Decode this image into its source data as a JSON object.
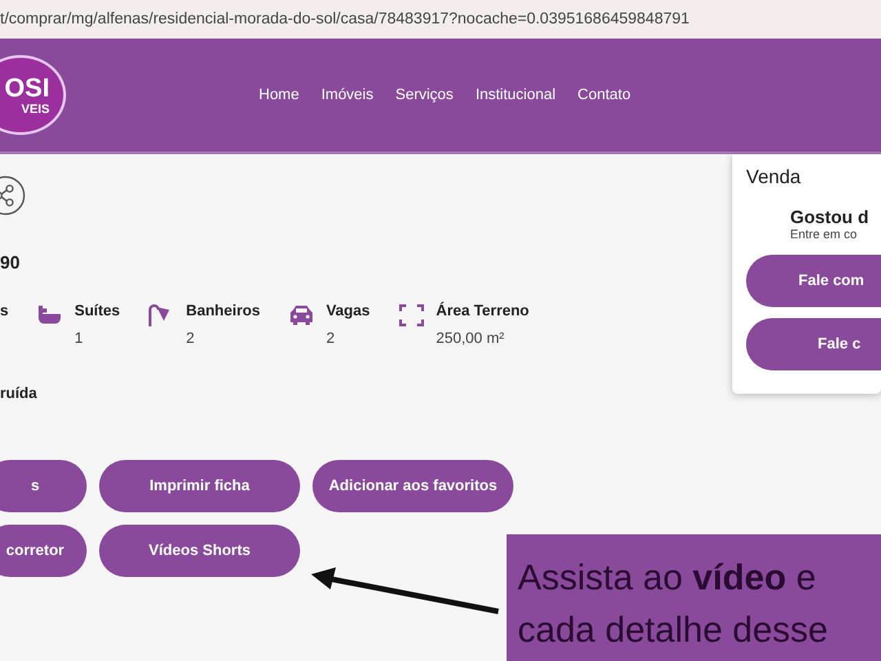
{
  "address_bar": {
    "url": "t/comprar/mg/alfenas/residencial-morada-do-sol/casa/78483917?nocache=0.03951686459848791"
  },
  "header": {
    "logo": {
      "line1": "OSI",
      "line2": "VEIS"
    },
    "nav": [
      "Home",
      "Imóveis",
      "Serviços",
      "Institucional",
      "Contato"
    ]
  },
  "listing": {
    "price_fragment": "90",
    "features": [
      {
        "label": "s"
      },
      {
        "kind": "bathtub",
        "label": "Suítes",
        "value": "1"
      },
      {
        "kind": "shower",
        "label": "Banheiros",
        "value": "2"
      },
      {
        "kind": "car",
        "label": "Vagas",
        "value": "2"
      },
      {
        "kind": "area",
        "label": "Área Terreno",
        "value": "250,00 m²"
      }
    ],
    "status_fragment": "ruída",
    "actions": [
      [
        "s",
        "Imprimir ficha",
        "Adicionar aos favoritos"
      ],
      [
        "corretor",
        "Vídeos Shorts"
      ]
    ]
  },
  "sidebar_card": {
    "title": "Venda",
    "heading": "Gostou d",
    "subtext": "Entre em co",
    "buttons": [
      "Fale com",
      "Fale c"
    ]
  },
  "callout": {
    "lines": [
      "Assista ao **vídeo** e",
      "cada detalhe desse"
    ]
  }
}
